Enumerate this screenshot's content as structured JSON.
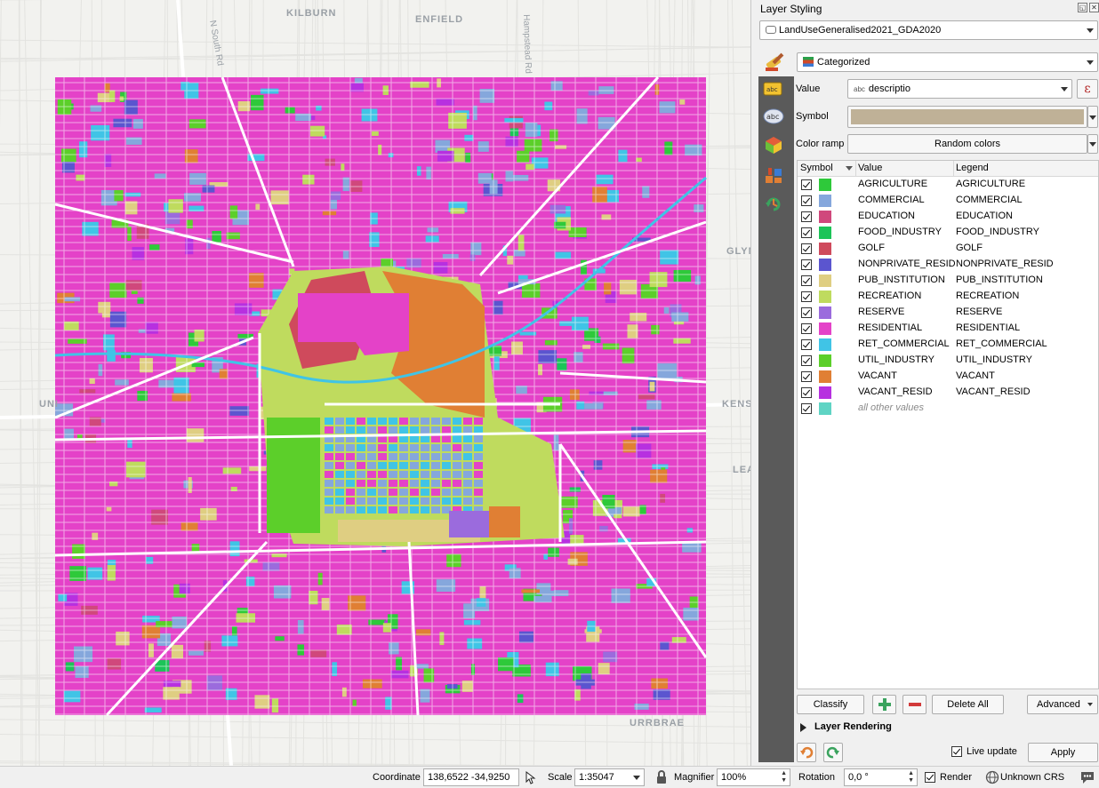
{
  "map": {
    "suburbs": [
      "KILBURN",
      "ENFIELD",
      "GLYN",
      "KENS",
      "LEA",
      "UNI",
      "URRBRAE"
    ],
    "streets": [
      "N South Rd",
      "Hampstead Rd"
    ],
    "colors": {
      "background": "#f2f2ef",
      "residential": "#e442c8",
      "water": "#9ec7d8",
      "road": "#ffffff"
    }
  },
  "panel": {
    "title": "Layer Styling",
    "float_icon": "float-icon",
    "close_icon": "close-icon",
    "layer_combo": "LandUseGeneralised2021_GDA2020",
    "renderer": "Categorized",
    "value_label": "Value",
    "value_field": "descriptio",
    "value_field_type": "abc",
    "expression_icon": "ε",
    "symbol_label": "Symbol",
    "symbol_color": "#bfb197",
    "color_ramp_label": "Color ramp",
    "color_ramp": "Random colors",
    "table": {
      "headers": [
        "Symbol",
        "Value",
        "Legend"
      ],
      "rows": [
        {
          "value": "AGRICULTURE",
          "legend": "AGRICULTURE",
          "color": "#2ec93a"
        },
        {
          "value": "COMMERCIAL",
          "legend": "COMMERCIAL",
          "color": "#85a7dc"
        },
        {
          "value": "EDUCATION",
          "legend": "EDUCATION",
          "color": "#d0487c"
        },
        {
          "value": "FOOD_INDUSTRY",
          "legend": "FOOD_INDUSTRY",
          "color": "#1cc458"
        },
        {
          "value": "GOLF",
          "legend": "GOLF",
          "color": "#cf4a5c"
        },
        {
          "value": "NONPRIVATE_RESID",
          "legend": "NONPRIVATE_RESID",
          "color": "#5b55cf"
        },
        {
          "value": "PUB_INSTITUTION",
          "legend": "PUB_INSTITUTION",
          "color": "#dfce82"
        },
        {
          "value": "RECREATION",
          "legend": "RECREATION",
          "color": "#bfdb5e"
        },
        {
          "value": "RESERVE",
          "legend": "RESERVE",
          "color": "#9b6bdd"
        },
        {
          "value": "RESIDENTIAL",
          "legend": "RESIDENTIAL",
          "color": "#e442c8"
        },
        {
          "value": "RET_COMMERCIAL",
          "legend": "RET_COMMERCIAL",
          "color": "#40c4e6"
        },
        {
          "value": "UTIL_INDUSTRY",
          "legend": "UTIL_INDUSTRY",
          "color": "#5ccf2a"
        },
        {
          "value": "VACANT",
          "legend": "VACANT",
          "color": "#e07f34"
        },
        {
          "value": "VACANT_RESID",
          "legend": "VACANT_RESID",
          "color": "#b730e0"
        },
        {
          "value": "all other values",
          "legend": "",
          "color": "#5fd4c4"
        }
      ]
    },
    "buttons": {
      "classify": "Classify",
      "delete_all": "Delete All",
      "advanced": "Advanced",
      "apply": "Apply"
    },
    "layer_rendering": "Layer Rendering",
    "live_update": "Live update"
  },
  "statusbar": {
    "coordinate_label": "Coordinate",
    "coordinate": "138,6522 -34,9250",
    "scale_label": "Scale",
    "scale": "1:35047",
    "magnifier_label": "Magnifier",
    "magnifier": "100%",
    "rotation_label": "Rotation",
    "rotation": "0,0 °",
    "render_label": "Render",
    "crs": "Unknown CRS"
  }
}
